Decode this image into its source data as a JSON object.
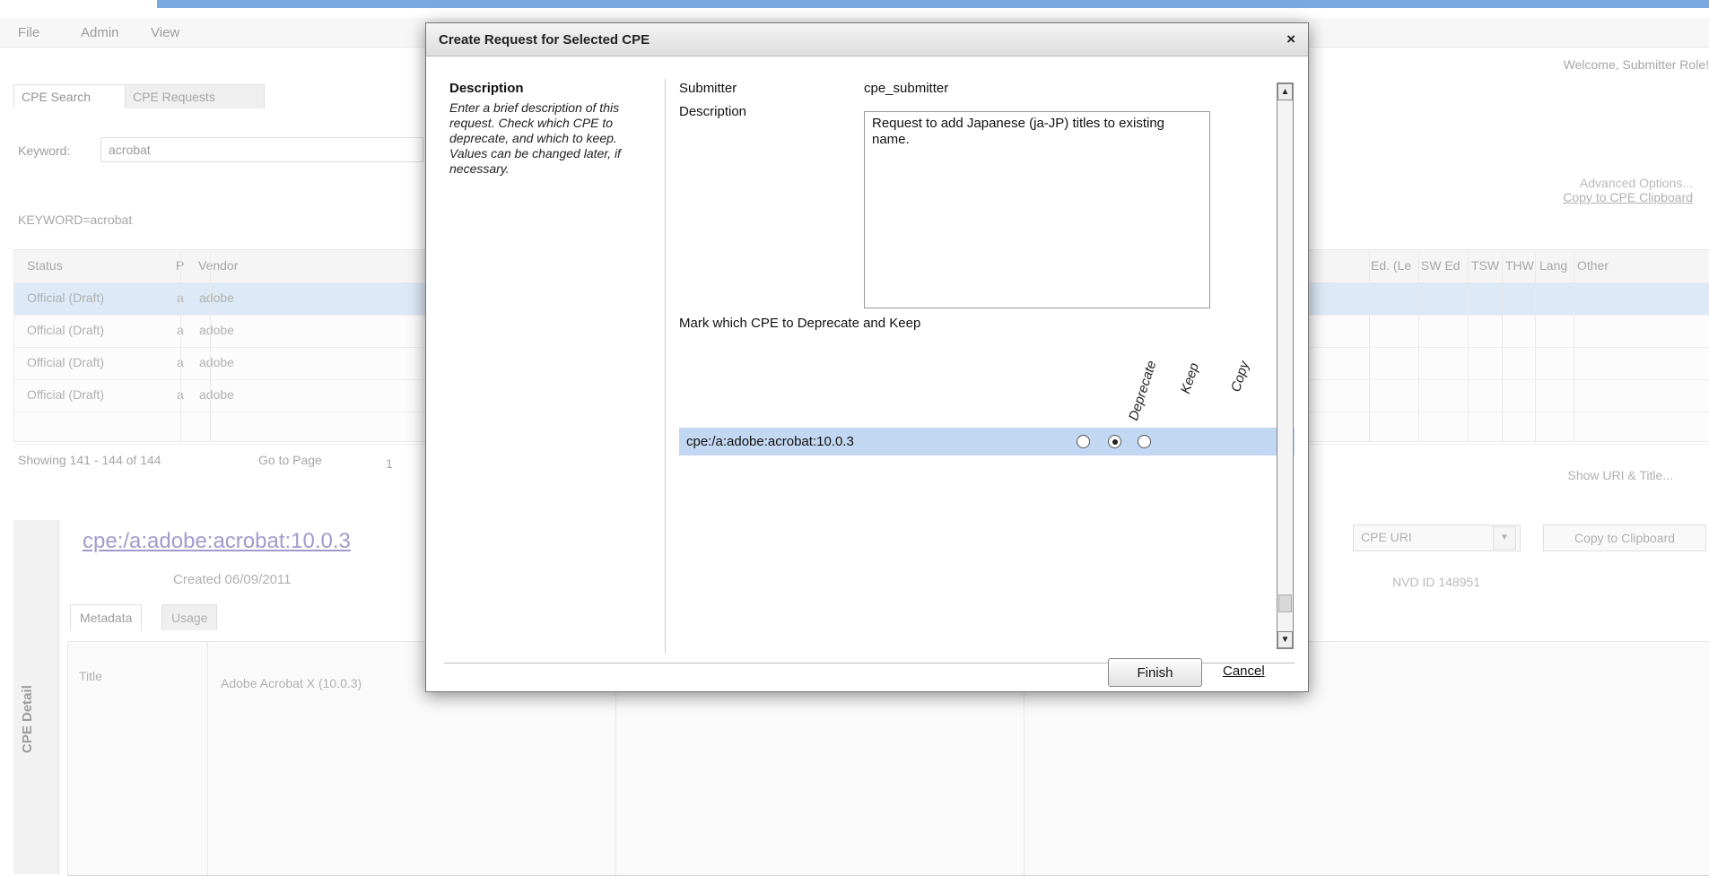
{
  "menu": [
    "File",
    "Admin",
    "View"
  ],
  "welcome": "Welcome, Submitter Role!",
  "tabs": {
    "cpe_search": "CPE Search",
    "cpe_requests": "CPE Requests"
  },
  "search": {
    "keyword_label": "Keyword:",
    "keyword_value": "acrobat",
    "query_text": "KEYWORD=acrobat",
    "advanced_options": "Advanced Options...",
    "copy_to_clipboard": "Copy to CPE Clipboard"
  },
  "results": {
    "columns_left": [
      "Status",
      "P",
      "Vendor"
    ],
    "columns_right": [
      "Ed. (Le",
      "SW Ed",
      "TSW",
      "THW",
      "Lang",
      "Other"
    ],
    "rows": [
      {
        "status": "Official (Draft)",
        "part": "a",
        "vendor": "adobe"
      },
      {
        "status": "Official (Draft)",
        "part": "a",
        "vendor": "adobe"
      },
      {
        "status": "Official (Draft)",
        "part": "a",
        "vendor": "adobe"
      },
      {
        "status": "Official (Draft)",
        "part": "a",
        "vendor": "adobe"
      }
    ],
    "showing": "Showing 141 - 144 of 144",
    "goto_page": "Go to Page",
    "page": "1",
    "show_uri_title": "Show URI & Title..."
  },
  "detail": {
    "side_label": "CPE Detail",
    "cpe_name": "cpe:/a:adobe:acrobat:10.0.3",
    "created": "Created 06/09/2011",
    "tabs": [
      "Metadata",
      "Usage"
    ],
    "uri_select": "CPE URI",
    "copy_to_clipboard": "Copy to Clipboard",
    "nvd_id": "NVD ID 148951",
    "meta_label": "Title",
    "meta_value": "Adobe Acrobat X (10.0.3)"
  },
  "dialog": {
    "title": "Create Request for Selected CPE",
    "close": "×",
    "description_heading": "Description",
    "description_help": "Enter a brief description of this request. Check which CPE to deprecate, and which to keep. Values can be changed later, if necessary.",
    "submitter_label": "Submitter",
    "submitter_value": "cpe_submitter",
    "description_label": "Description",
    "description_value": "Request to add Japanese (ja-JP) titles to existing name.",
    "mark_instruction": "Mark which CPE to Deprecate and Keep",
    "col_deprecate": "Deprecate",
    "col_keep": "Keep",
    "col_copy": "Copy",
    "cpe_row": "cpe:/a:adobe:acrobat:10.0.3",
    "scroll_up": "▲",
    "scroll_down": "▼",
    "finish": "Finish",
    "cancel": "Cancel"
  }
}
